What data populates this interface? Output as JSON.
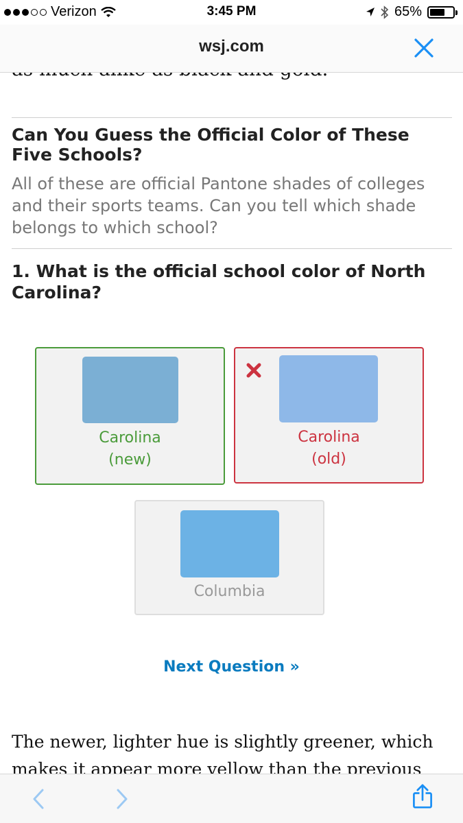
{
  "status_bar": {
    "carrier": "Verizon",
    "time": "3:45 PM",
    "battery_percent": "65%",
    "battery_level": 0.65,
    "signal_bars": 3,
    "signal_total": 5
  },
  "browser": {
    "url": "wsj.com"
  },
  "article": {
    "cut_top_text": "as much alike as black and gold.",
    "bottom_text": "The newer, lighter hue is slightly greener, which makes it appear more yellow than the previous"
  },
  "quiz": {
    "title": "Can You Guess the Official Color of These Five Schools?",
    "description": "All of these are official Pantone shades of colleges and their sports teams. Can you tell which shade belongs to which school?",
    "question": "1. What is the official school color of North Carolina?",
    "options": [
      {
        "line1": "Carolina",
        "line2": "(new)",
        "state": "correct",
        "swatch_color": "#7bafd4",
        "label_color": "#4a9b3a"
      },
      {
        "line1": "Carolina",
        "line2": "(old)",
        "state": "wrong",
        "swatch_color": "#8eb8e8",
        "label_color": "#cc3340"
      },
      {
        "line1": "Columbia",
        "line2": "",
        "state": "neutral",
        "swatch_color": "#6cb2e5",
        "label_color": "#999999"
      }
    ],
    "next_label": "Next Question »"
  },
  "colors": {
    "link_blue": "#0a7bbf",
    "ios_blue": "#1a8ff5",
    "correct_green": "#4a9b3a",
    "wrong_red": "#cc3340"
  },
  "icons": {
    "close": "close-icon",
    "wrong": "x-mark-icon",
    "back": "chevron-left-icon",
    "forward": "chevron-right-icon",
    "share": "share-icon"
  }
}
